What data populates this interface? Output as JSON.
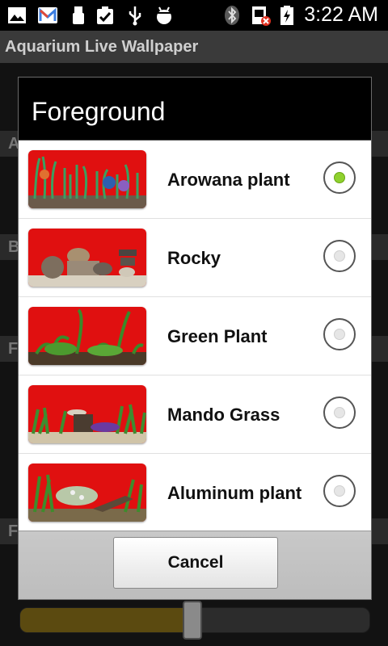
{
  "status_bar": {
    "time": "3:22 AM",
    "icons": [
      "gallery-icon",
      "gmail-icon",
      "usb-icon",
      "clipboard-check-icon",
      "usb-debug-icon",
      "android-debug-icon",
      "bluetooth-icon",
      "sim-error-icon",
      "battery-charging-icon"
    ]
  },
  "app": {
    "title": "Aquarium Live Wallpaper",
    "section_initials": [
      "A",
      "B",
      "F",
      "F"
    ],
    "slider_fraction": 0.49
  },
  "dialog": {
    "title": "Foreground",
    "options": [
      {
        "label": "Arowana plant",
        "selected": true
      },
      {
        "label": "Rocky",
        "selected": false
      },
      {
        "label": "Green Plant",
        "selected": false
      },
      {
        "label": "Mando Grass",
        "selected": false
      },
      {
        "label": "Aluminum plant",
        "selected": false
      }
    ],
    "cancel_label": "Cancel"
  },
  "colors": {
    "thumbnail_bg": "#e01010",
    "radio_selected": "#8fd12e",
    "slider_fill": "#5b4a10"
  }
}
